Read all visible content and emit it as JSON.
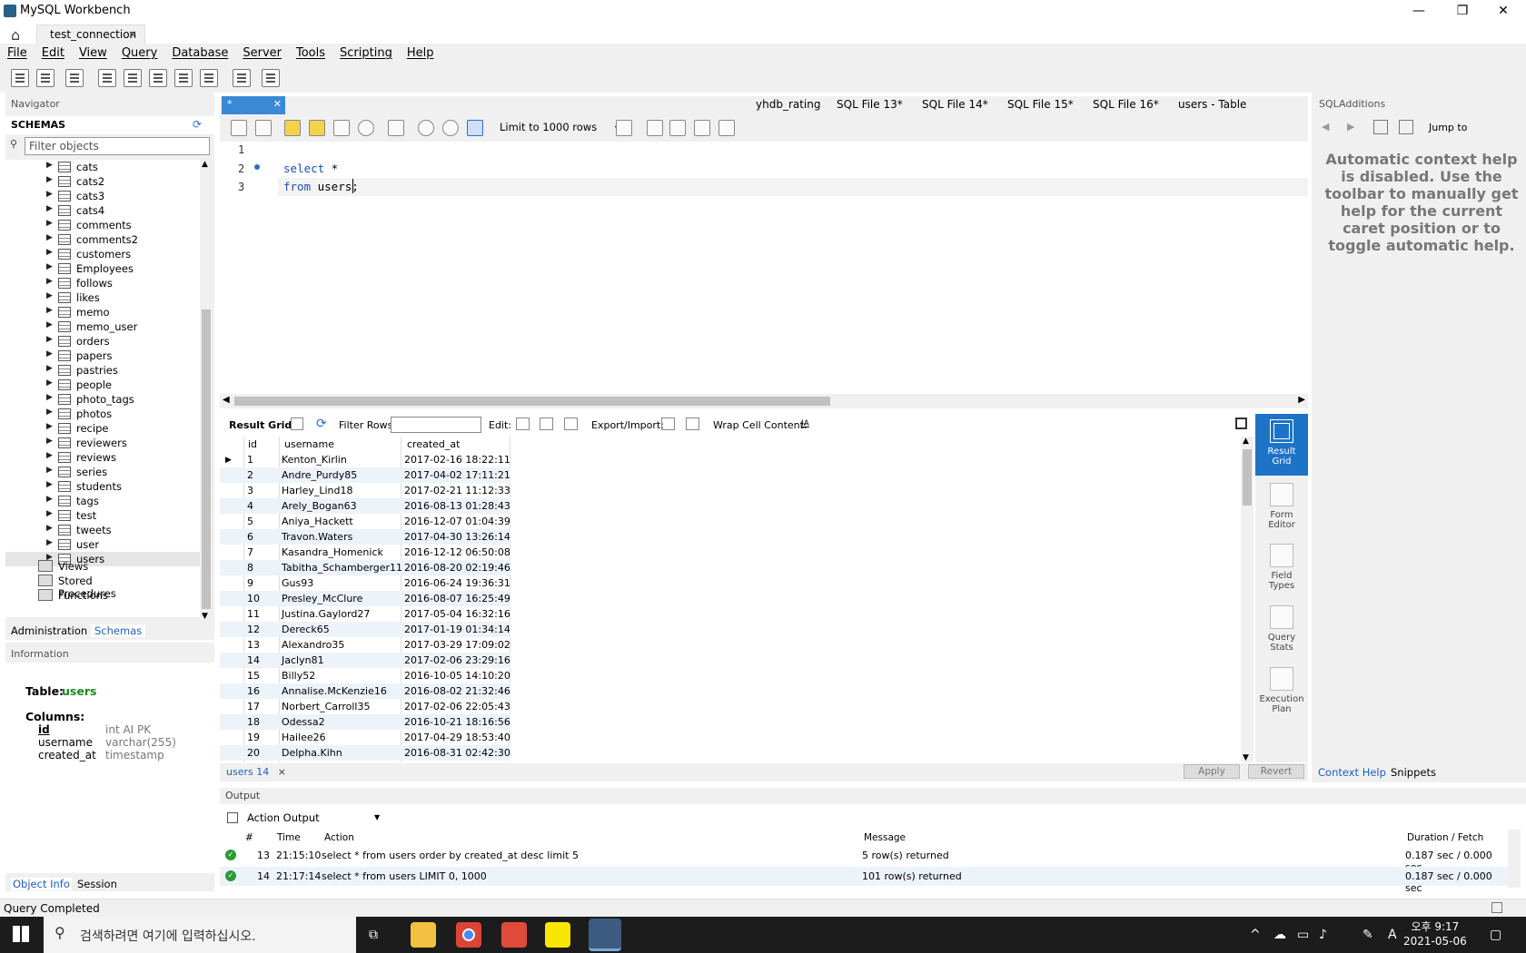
{
  "window": {
    "title": "MySQL Workbench",
    "minimize": "—",
    "restore": "❐",
    "close": "✕"
  },
  "connection_tab": {
    "label": "test_connection",
    "close": "×"
  },
  "menu": [
    "File",
    "Edit",
    "View",
    "Query",
    "Database",
    "Server",
    "Tools",
    "Scripting",
    "Help"
  ],
  "navigator": {
    "title": "Navigator",
    "schemas_title": "SCHEMAS",
    "filter_placeholder": "Filter objects",
    "tables": [
      "cats",
      "cats2",
      "cats3",
      "cats4",
      "comments",
      "comments2",
      "customers",
      "Employees",
      "follows",
      "likes",
      "memo",
      "memo_user",
      "orders",
      "papers",
      "pastries",
      "people",
      "photo_tags",
      "photos",
      "recipe",
      "reviewers",
      "reviews",
      "series",
      "students",
      "tags",
      "test",
      "tweets",
      "user",
      "users"
    ],
    "selected": "users",
    "folders": [
      "Views",
      "Stored Procedures",
      "Functions"
    ],
    "tabs": [
      "Administration",
      "Schemas"
    ],
    "active_tab": "Schemas"
  },
  "information": {
    "title": "Information",
    "table_label": "Table:",
    "table_name": "users",
    "columns_label": "Columns:",
    "columns": [
      {
        "name": "id",
        "type": "int AI PK"
      },
      {
        "name": "username",
        "type": "varchar(255)"
      },
      {
        "name": "created_at",
        "type": "timestamp"
      }
    ],
    "bottom_tabs": [
      "Object Info",
      "Session"
    ]
  },
  "editor": {
    "active_tab": "*",
    "tabs": [
      "yhdb_rating",
      "SQL File 13*",
      "SQL File 14*",
      "SQL File 15*",
      "SQL File 16*",
      "users - Table"
    ],
    "limit": "Limit to 1000 rows",
    "line_numbers": [
      "1",
      "2",
      "3"
    ],
    "code": [
      {
        "kw": "select",
        "rest": " *"
      },
      {
        "kw": "from",
        "rest": " users;"
      }
    ]
  },
  "result_toolbar": {
    "result_grid": "Result Grid",
    "filter_rows": "Filter Rows:",
    "edit": "Edit:",
    "export_import": "Export/Import:",
    "wrap": "Wrap Cell Content:",
    "wrap_icon": "IA"
  },
  "grid": {
    "columns": [
      "id",
      "username",
      "created_at"
    ],
    "rows": [
      [
        "1",
        "Kenton_Kirlin",
        "2017-02-16 18:22:11"
      ],
      [
        "2",
        "Andre_Purdy85",
        "2017-04-02 17:11:21"
      ],
      [
        "3",
        "Harley_Lind18",
        "2017-02-21 11:12:33"
      ],
      [
        "4",
        "Arely_Bogan63",
        "2016-08-13 01:28:43"
      ],
      [
        "5",
        "Aniya_Hackett",
        "2016-12-07 01:04:39"
      ],
      [
        "6",
        "Travon.Waters",
        "2017-04-30 13:26:14"
      ],
      [
        "7",
        "Kasandra_Homenick",
        "2016-12-12 06:50:08"
      ],
      [
        "8",
        "Tabitha_Schamberger11",
        "2016-08-20 02:19:46"
      ],
      [
        "9",
        "Gus93",
        "2016-06-24 19:36:31"
      ],
      [
        "10",
        "Presley_McClure",
        "2016-08-07 16:25:49"
      ],
      [
        "11",
        "Justina.Gaylord27",
        "2017-05-04 16:32:16"
      ],
      [
        "12",
        "Dereck65",
        "2017-01-19 01:34:14"
      ],
      [
        "13",
        "Alexandro35",
        "2017-03-29 17:09:02"
      ],
      [
        "14",
        "Jaclyn81",
        "2017-02-06 23:29:16"
      ],
      [
        "15",
        "Billy52",
        "2016-10-05 14:10:20"
      ],
      [
        "16",
        "Annalise.McKenzie16",
        "2016-08-02 21:32:46"
      ],
      [
        "17",
        "Norbert_Carroll35",
        "2017-02-06 22:05:43"
      ],
      [
        "18",
        "Odessa2",
        "2016-10-21 18:16:56"
      ],
      [
        "19",
        "Hailee26",
        "2017-04-29 18:53:40"
      ],
      [
        "20",
        "Delpha.Kihn",
        "2016-08-31 02:42:30"
      ]
    ]
  },
  "rail": [
    {
      "label1": "Result",
      "label2": "Grid"
    },
    {
      "label1": "Form",
      "label2": "Editor"
    },
    {
      "label1": "Field",
      "label2": "Types"
    },
    {
      "label1": "Query",
      "label2": "Stats"
    },
    {
      "label1": "Execution",
      "label2": "Plan"
    }
  ],
  "result_tab": {
    "label": "users 14",
    "close": "×",
    "apply": "Apply",
    "revert": "Revert"
  },
  "output": {
    "title": "Output",
    "mode": "Action Output",
    "columns": [
      "#",
      "Time",
      "Action",
      "Message",
      "Duration / Fetch"
    ],
    "rows": [
      {
        "num": "13",
        "time": "21:15:10",
        "action": "select * from users order by created_at desc limit 5",
        "message": "5 row(s) returned",
        "duration": "0.187 sec / 0.000 sec"
      },
      {
        "num": "14",
        "time": "21:17:14",
        "action": "select * from users LIMIT 0, 1000",
        "message": "101 row(s) returned",
        "duration": "0.187 sec / 0.000 sec"
      }
    ]
  },
  "sql_additions": {
    "title": "SQLAdditions",
    "jump_to": "Jump to",
    "help": "Automatic context help is disabled. Use the toolbar to manually get help for the current caret position or to toggle automatic help.",
    "tabs": [
      "Context Help",
      "Snippets"
    ]
  },
  "status": "Query Completed",
  "taskbar": {
    "search": "검색하려면 여기에 입력하십시오.",
    "time": "오후 9:17",
    "date": "2021-05-06",
    "lang": "A"
  },
  "colors": {
    "accent": "#1d74c6",
    "tab_active": "#3a89d7",
    "table_name": "#1a8a1a",
    "ok": "#2e9a3a"
  }
}
